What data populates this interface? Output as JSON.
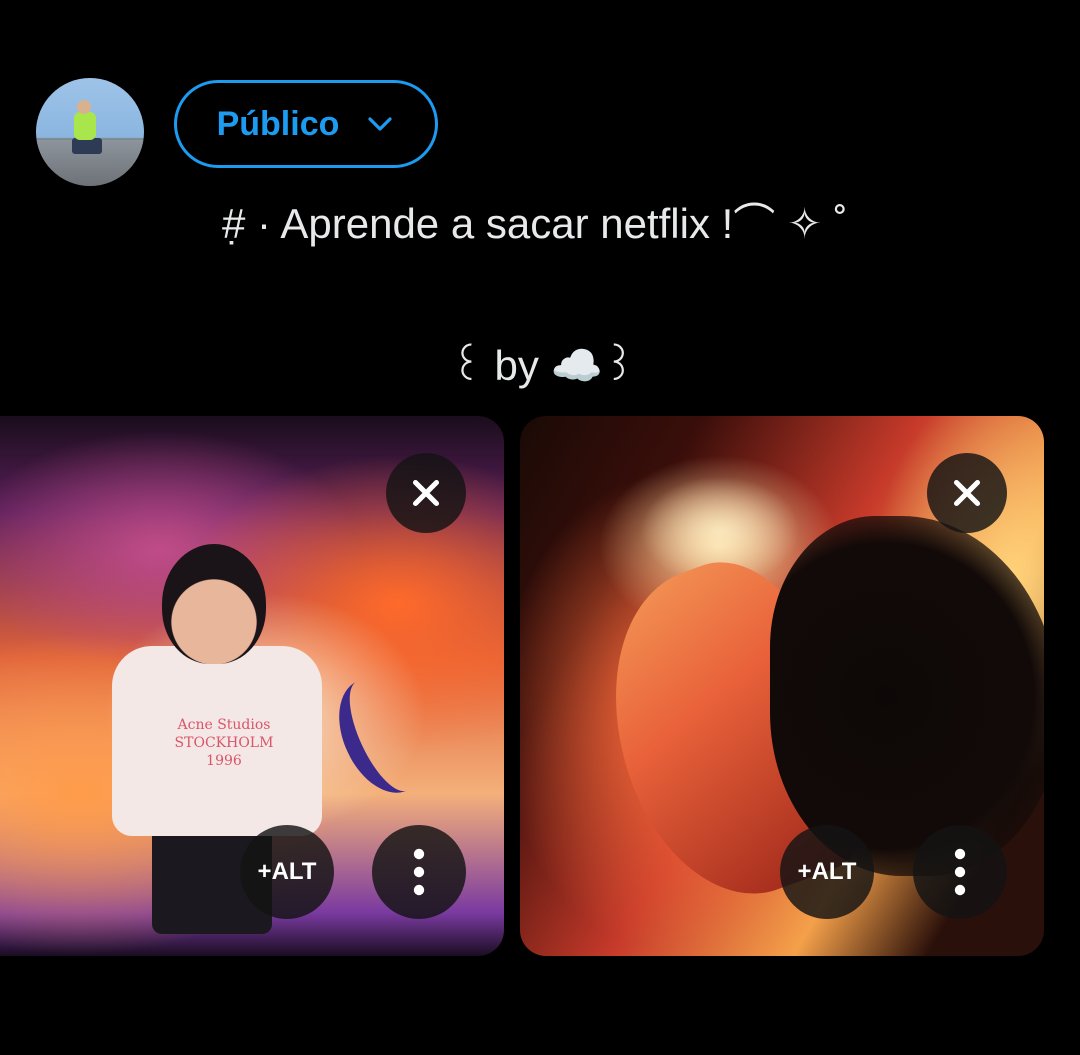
{
  "composer": {
    "audience_label": "Público",
    "tweet_line1": "#̣ · Aprende a sacar netflix !⌒ ✧ ˚",
    "tweet_line2": "꒰ by ☁️꒱"
  },
  "media": [
    {
      "shirt_text": [
        "Acne Studios",
        "STOCKHOLM",
        "1996"
      ],
      "alt_label": "+ALT"
    },
    {
      "alt_label": "+ALT"
    }
  ],
  "colors": {
    "accent": "#1d9bf0",
    "background": "#000000",
    "text": "#e7e9ea"
  },
  "icons": {
    "audience_dropdown": "chevron-down-icon",
    "remove_media": "close-icon",
    "media_menu": "more-vertical-icon"
  }
}
